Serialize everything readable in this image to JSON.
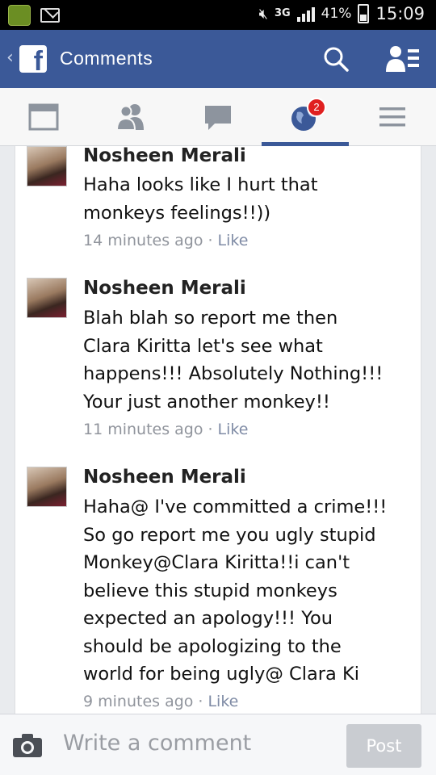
{
  "status_bar": {
    "network": "3G",
    "battery": "41%",
    "time": "15:09"
  },
  "header": {
    "logo": "f",
    "title": "Comments",
    "icons": [
      "back-chevron-icon",
      "facebook-logo",
      "search-icon",
      "friend-requests-icon"
    ]
  },
  "tabs": [
    {
      "name": "news-feed",
      "icon": "news-feed-icon",
      "active": false
    },
    {
      "name": "friends",
      "icon": "friends-icon",
      "active": false
    },
    {
      "name": "messages",
      "icon": "messages-icon",
      "active": false
    },
    {
      "name": "notifications",
      "icon": "globe-icon",
      "active": true,
      "badge": "2"
    },
    {
      "name": "more",
      "icon": "menu-icon",
      "active": false
    }
  ],
  "comments": [
    {
      "author": "Nosheen Merali",
      "text": "Haha looks like I hurt that\nmonkeys feelings!!))",
      "time": "14 minutes ago",
      "dot": "·",
      "like": "Like"
    },
    {
      "author": "Nosheen Merali",
      "text": "Blah blah so report me then\nClara Kiritta let's see what\nhappens!!! Absolutely Nothing!!!\nYour just another monkey!!",
      "time": "11 minutes ago",
      "dot": "·",
      "like": "Like"
    },
    {
      "author": "Nosheen Merali",
      "text": "Haha@ I've committed a crime!!!\nSo go report me you ugly stupid\nMonkey@Clara Kiritta!!i can't\nbelieve this stupid monkeys\nexpected an apology!!! You\nshould be apologizing to the\nworld for being ugly@ Clara Ki",
      "time": "9 minutes ago",
      "dot": "·",
      "like": "Like"
    }
  ],
  "composer": {
    "placeholder": "Write a comment",
    "post_label": "Post"
  },
  "colors": {
    "facebook_blue": "#3b5998",
    "badge_red": "#e02020",
    "meta_gray": "#90949c"
  }
}
